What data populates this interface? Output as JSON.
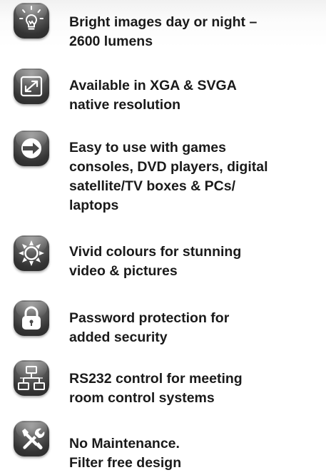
{
  "features": [
    {
      "icon": "lightbulb-icon",
      "lines": [
        "Bright images day or night –",
        "2600 lumens"
      ]
    },
    {
      "icon": "resize-arrow-icon",
      "lines": [
        "Available in XGA & SVGA",
        "native resolution"
      ]
    },
    {
      "icon": "arrow-right-icon",
      "lines": [
        "Easy to use with games",
        "consoles, DVD players, digital",
        "satellite/TV boxes & PCs/",
        "laptops"
      ]
    },
    {
      "icon": "sun-icon",
      "lines": [
        "Vivid colours for stunning",
        "video & pictures"
      ]
    },
    {
      "icon": "padlock-icon",
      "lines": [
        "Password protection for",
        "added security"
      ]
    },
    {
      "icon": "network-icon",
      "lines": [
        "RS232 control for meeting",
        "room control systems"
      ]
    },
    {
      "icon": "tools-icon",
      "lines": [
        "No Maintenance.",
        "Filter free design"
      ]
    }
  ]
}
